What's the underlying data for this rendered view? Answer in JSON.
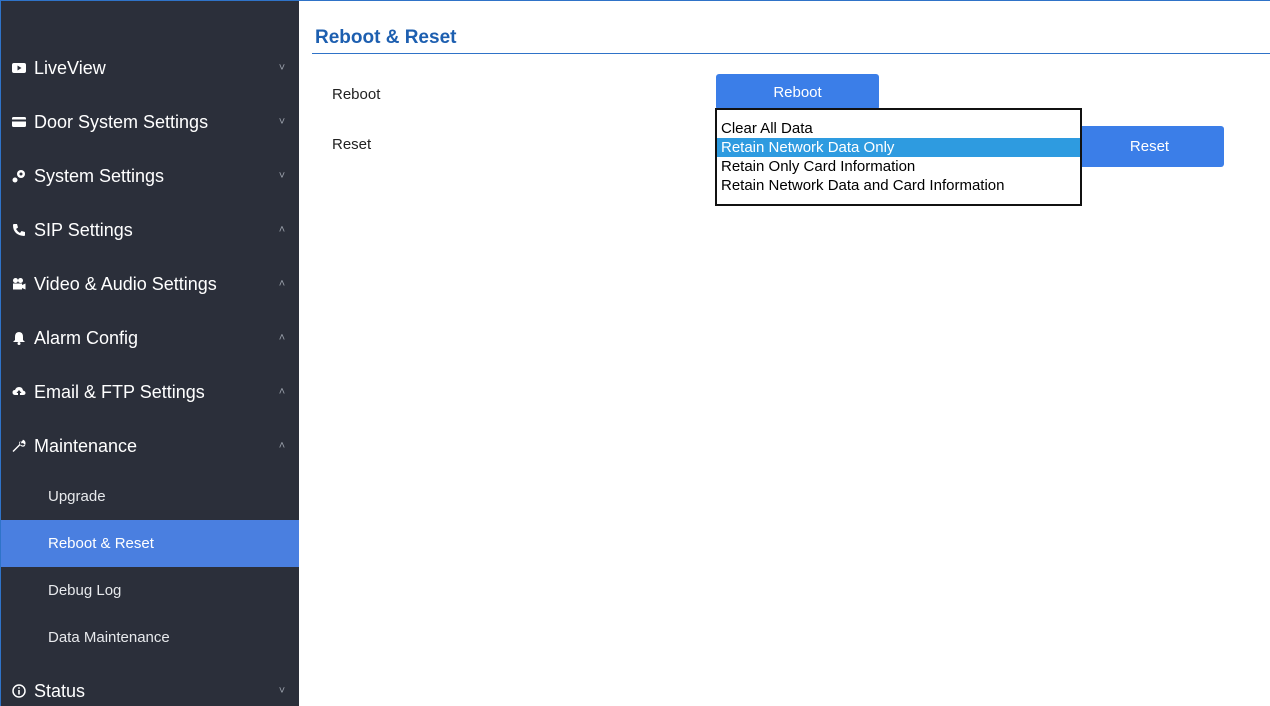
{
  "sidebar": {
    "items": [
      {
        "label": "LiveView",
        "icon": "video-play-icon",
        "chevron": "˅"
      },
      {
        "label": "Door System Settings",
        "icon": "card-icon",
        "chevron": "˅"
      },
      {
        "label": "System Settings",
        "icon": "settings-icon",
        "chevron": "˅"
      },
      {
        "label": "SIP Settings",
        "icon": "phone-icon",
        "chevron": "˄"
      },
      {
        "label": "Video & Audio Settings",
        "icon": "camera-icon",
        "chevron": "˄"
      },
      {
        "label": "Alarm Config",
        "icon": "bell-icon",
        "chevron": "˄"
      },
      {
        "label": "Email & FTP Settings",
        "icon": "cloud-icon",
        "chevron": "˄"
      },
      {
        "label": "Maintenance",
        "icon": "wrench-icon",
        "chevron": "˄"
      }
    ],
    "maintenance_sub": [
      {
        "label": "Upgrade"
      },
      {
        "label": "Reboot & Reset",
        "active": true
      },
      {
        "label": "Debug Log"
      },
      {
        "label": "Data Maintenance"
      }
    ],
    "status": {
      "label": "Status",
      "icon": "info-icon",
      "chevron": "˅"
    }
  },
  "main": {
    "title": "Reboot & Reset",
    "reboot_label": "Reboot",
    "reboot_button": "Reboot",
    "reset_label": "Reset",
    "reset_button": "Reset",
    "reset_dropdown": {
      "options": [
        "Clear All Data",
        "Retain Network Data Only",
        "Retain Only Card Information",
        "Retain Network Data and Card Information"
      ],
      "highlighted": "Retain Network Data Only"
    }
  },
  "colors": {
    "sidebar_bg": "#2b2f3a",
    "active_bg": "#4a7fe0",
    "button_bg": "#3b7ee8",
    "title": "#1d5fb0",
    "highlight": "#2e9be0"
  }
}
